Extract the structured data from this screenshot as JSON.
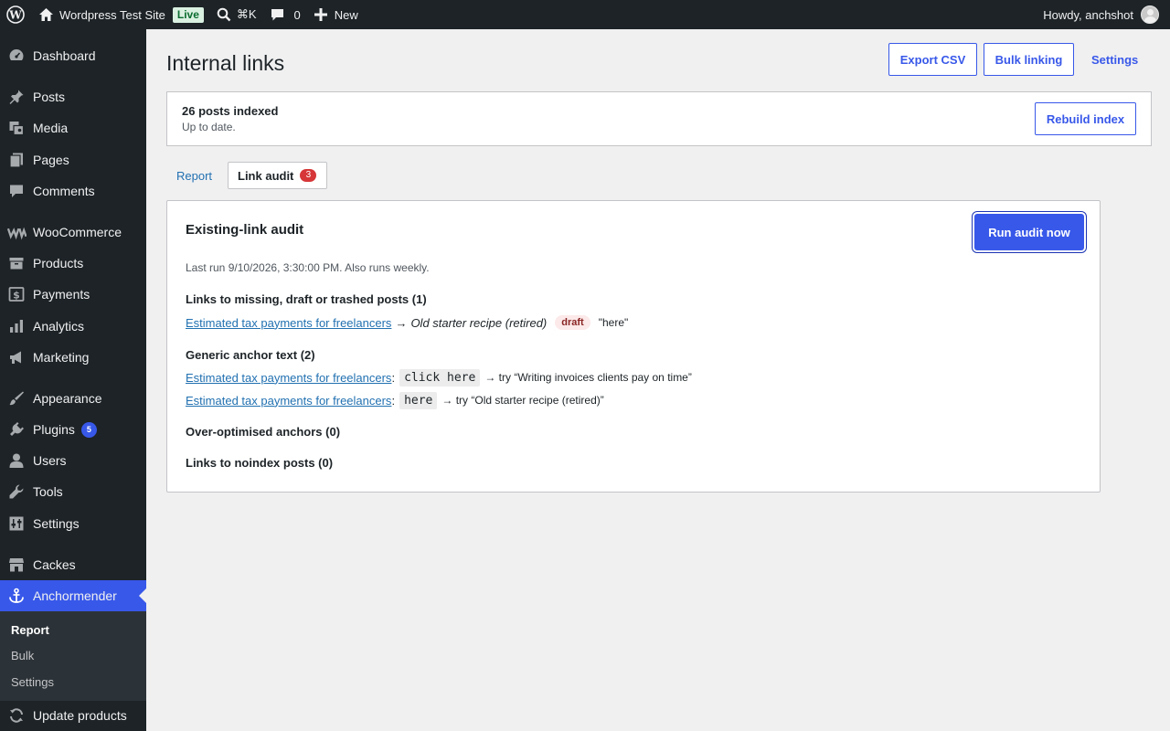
{
  "adminbar": {
    "site_name": "Wordpress Test Site",
    "live_badge": "Live",
    "search_shortcut": "⌘K",
    "comments_count": "0",
    "new_label": "New",
    "howdy": "Howdy, anchshot"
  },
  "sidebar": {
    "items": [
      {
        "label": "Dashboard"
      },
      {
        "label": "Posts"
      },
      {
        "label": "Media"
      },
      {
        "label": "Pages"
      },
      {
        "label": "Comments"
      },
      {
        "label": "WooCommerce"
      },
      {
        "label": "Products"
      },
      {
        "label": "Payments"
      },
      {
        "label": "Analytics"
      },
      {
        "label": "Marketing"
      },
      {
        "label": "Appearance"
      },
      {
        "label": "Plugins",
        "badge": "5"
      },
      {
        "label": "Users"
      },
      {
        "label": "Tools"
      },
      {
        "label": "Settings"
      },
      {
        "label": "Cackes"
      },
      {
        "label": "Anchormender"
      },
      {
        "label": "Update products"
      }
    ],
    "submenu": [
      "Report",
      "Bulk",
      "Settings"
    ]
  },
  "page": {
    "title": "Internal links",
    "export_csv": "Export CSV",
    "bulk_linking": "Bulk linking",
    "settings": "Settings"
  },
  "index_status": {
    "title": "26 posts indexed",
    "subtitle": "Up to date.",
    "rebuild": "Rebuild index"
  },
  "tabs": {
    "report": "Report",
    "audit": "Link audit",
    "audit_count": "3"
  },
  "audit": {
    "title": "Existing-link audit",
    "run_button": "Run audit now",
    "last_run": "Last run 9/10/2026, 3:30:00 PM. Also runs weekly.",
    "missing": {
      "heading": "Links to missing, draft or trashed posts (1)",
      "rows": [
        {
          "source": "Estimated tax payments for freelancers",
          "arrow": "→",
          "target": "Old starter recipe (retired)",
          "status": "draft",
          "anchor": "\"here\""
        }
      ]
    },
    "generic": {
      "heading": "Generic anchor text (2)",
      "rows": [
        {
          "source": "Estimated tax payments for freelancers",
          "colon": ":",
          "anchor": "click here",
          "suggestion": "→ try “Writing invoices clients pay on time”"
        },
        {
          "source": "Estimated tax payments for freelancers",
          "colon": ":",
          "anchor": "here",
          "suggestion": "→ try “Old starter recipe (retired)”"
        }
      ]
    },
    "overoptimised_heading": "Over-optimised anchors (0)",
    "noindex_heading": "Links to noindex posts (0)"
  }
}
